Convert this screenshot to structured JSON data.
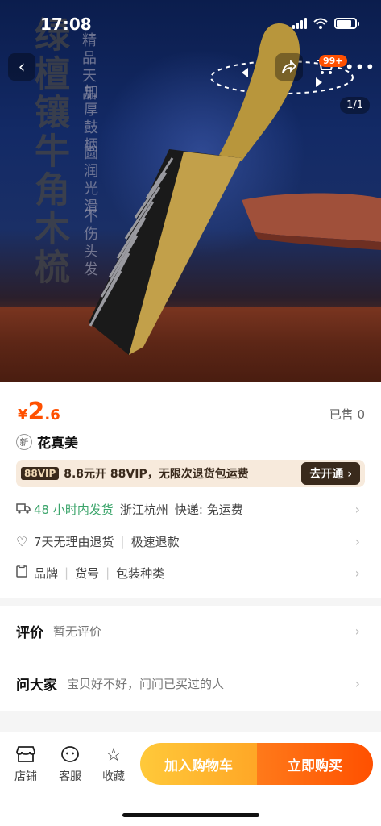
{
  "status_bar": {
    "time": "17:08"
  },
  "hero": {
    "vertical_title": "绿檀镶牛角木梳",
    "features": [
      "精品天品",
      "加厚鼓柄",
      "圆润光滑",
      "不伤头发"
    ],
    "cart_badge": "99+",
    "page_indicator": "1/1",
    "icons": {
      "back": "chevron-left-icon",
      "share": "share-icon",
      "cart": "cart-icon",
      "more": "more-icon"
    }
  },
  "product": {
    "price_symbol": "¥",
    "price_int": "2",
    "price_dec": ".6",
    "sold": "已售 0",
    "new_tag": "新",
    "title": "花真美"
  },
  "vip": {
    "tag": "88VIP",
    "text": "8.8元开 88VIP，无限次退货包运费",
    "button": "去开通 ›"
  },
  "shipping": {
    "delivery": "48 小时内发货",
    "location": "浙江杭州",
    "express": "快递: 免运费"
  },
  "service": {
    "returns": "7天无理由退货",
    "refund": "极速退款"
  },
  "params": {
    "items": [
      "品牌",
      "货号",
      "包装种类"
    ]
  },
  "reviews": {
    "title": "评价",
    "subtitle": "暂无评价"
  },
  "qa": {
    "title": "问大家",
    "subtitle": "宝贝好不好，问问已买过的人"
  },
  "bottom_bar": {
    "shop": "店铺",
    "service": "客服",
    "favorite": "收藏",
    "add_to_cart": "加入购物车",
    "buy_now": "立即购买"
  },
  "colors": {
    "accent": "#ff5000",
    "vip_bg": "#f7eadc",
    "green": "#3aa46a"
  }
}
